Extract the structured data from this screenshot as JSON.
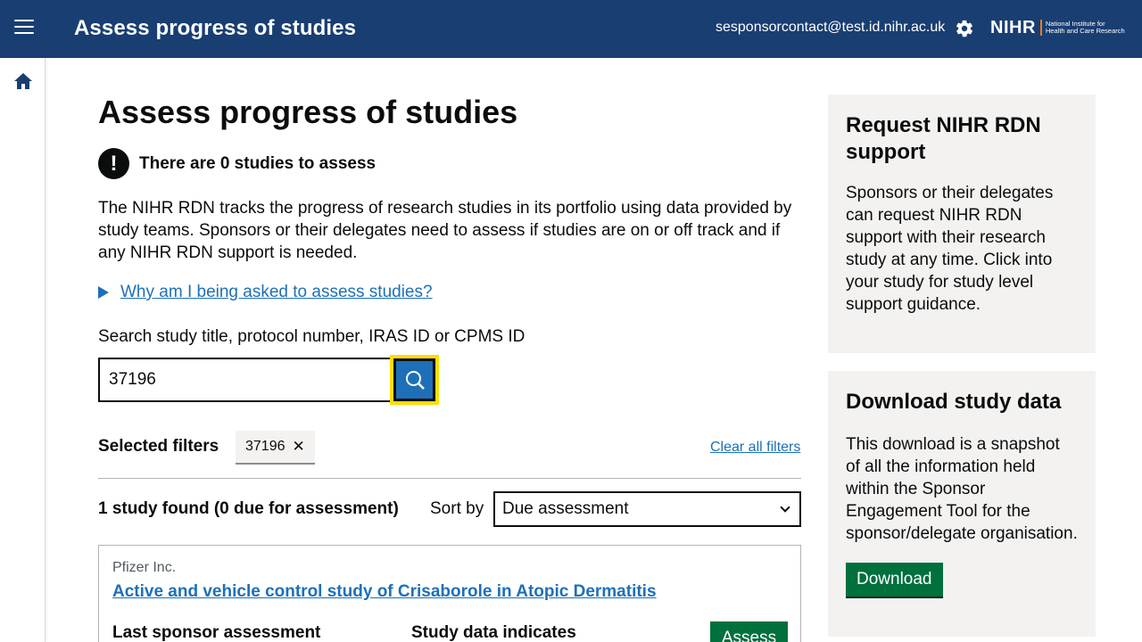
{
  "header": {
    "app_title": "Assess progress of studies",
    "user_email": "sesponsorcontact@test.id.nihr.ac.uk",
    "logo_main": "NIHR",
    "logo_sub_line1": "National Institute for",
    "logo_sub_line2": "Health and Care Research",
    "menu_icon": "menu-icon",
    "settings_icon": "gear-icon",
    "brand_color": "#193e72"
  },
  "sidenav": {
    "home_icon": "home-icon"
  },
  "main": {
    "page_title": "Assess progress of studies",
    "warning_text": "There are 0 studies to assess",
    "intro": "The NIHR RDN tracks the progress of research studies in its portfolio using data provided by study teams. Sponsors or their delegates need to assess if studies are on or off track and if any NIHR RDN support is needed.",
    "details_summary": "Why am I being asked to assess studies?",
    "search": {
      "label": "Search study title, protocol number, IRAS ID or CPMS ID",
      "value": "37196"
    },
    "filters": {
      "label": "Selected filters",
      "tags": [
        "37196"
      ],
      "clear_label": "Clear all filters"
    },
    "results": {
      "count_text": "1 study found (0 due for assessment)",
      "sort_label": "Sort by",
      "sort_selected": "Due assessment"
    },
    "study_card": {
      "sponsor": "Pfizer Inc.",
      "title": "Active and vehicle control study of Crisaborole in Atopic Dermatitis",
      "col1_heading": "Last sponsor assessment",
      "col2_heading": "Study data indicates",
      "action_label": "Assess"
    }
  },
  "sidebar": {
    "support_panel": {
      "heading": "Request NIHR RDN support",
      "body": "Sponsors or their delegates can request NIHR RDN support with their research study at any time. Click into your study for study level support guidance."
    },
    "download_panel": {
      "heading": "Download study data",
      "body": "This download is a snapshot of all the information held within the Sponsor Engagement Tool for the sponsor/delegate organisation.",
      "button_label": "Download"
    }
  },
  "colors": {
    "link": "#1d70b8",
    "primary_button": "#00703c",
    "focus": "#ffdd00",
    "panel_bg": "#f3f2f1"
  }
}
